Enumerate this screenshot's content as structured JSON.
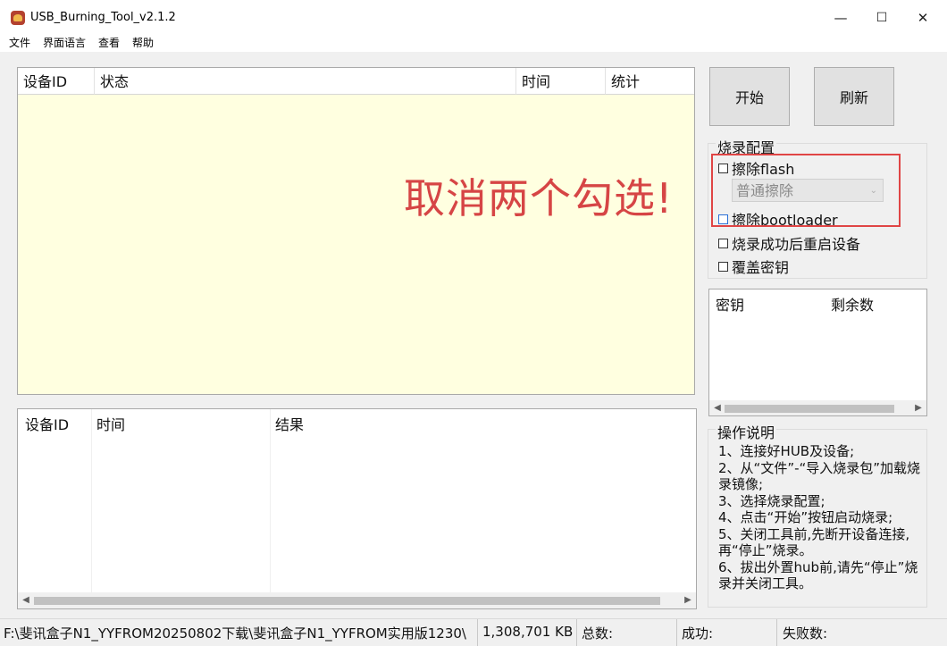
{
  "window": {
    "title": "USB_Burning_Tool_v2.1.2",
    "controls": {
      "minimize": "—",
      "maximize": "☐",
      "close": "✕"
    }
  },
  "menu": [
    "文件",
    "界面语言",
    "查看",
    "帮助"
  ],
  "device_table": {
    "headers": [
      "设备ID",
      "状态",
      "时间",
      "统计"
    ],
    "annotation": "取消两个勾选!"
  },
  "result_table": {
    "headers": [
      "设备ID",
      "时间",
      "结果"
    ]
  },
  "buttons": {
    "start": "开始",
    "refresh": "刷新"
  },
  "burn_config": {
    "title": "烧录配置",
    "erase_flash": {
      "label": "擦除flash",
      "checked": false
    },
    "erase_mode": "普通擦除",
    "erase_bootloader": {
      "label": "擦除bootloader",
      "checked": false
    },
    "reboot_after_success": {
      "label": "烧录成功后重启设备",
      "checked": false
    },
    "overwrite_key": {
      "label": "覆盖密钥",
      "checked": false
    }
  },
  "key_table": {
    "headers": [
      "密钥",
      "剩余数"
    ]
  },
  "help": {
    "title": "操作说明",
    "lines": [
      "1、连接好HUB及设备;",
      "2、从“文件”-“导入烧录包”加载烧录镜像;",
      "3、选择烧录配置;",
      "4、点击“开始”按钮启动烧录;",
      "5、关闭工具前,先断开设备连接,再“停止”烧录。",
      "6、拔出外置hub前,请先“停止”烧录并关闭工具。"
    ]
  },
  "status": {
    "path": "F:\\斐讯盒子N1_YYFROM20250802下载\\斐讯盒子N1_YYFROM实用版1230\\",
    "size": "1,308,701 KB",
    "total_label": "总数:",
    "success_label": "成功:",
    "fail_label": "失败数:"
  },
  "colors": {
    "device_list_bg": "#ffffe0",
    "annotation": "#d64545",
    "highlight_box": "#e04545"
  }
}
